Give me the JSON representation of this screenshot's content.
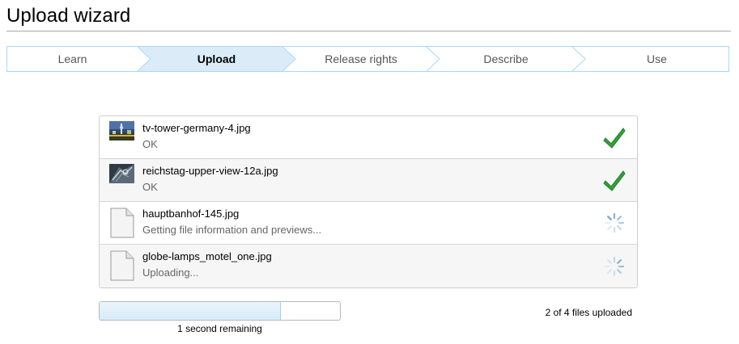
{
  "page": {
    "title": "Upload wizard"
  },
  "steps": [
    {
      "label": "Learn",
      "active": false
    },
    {
      "label": "Upload",
      "active": true
    },
    {
      "label": "Release rights",
      "active": false
    },
    {
      "label": "Describe",
      "active": false
    },
    {
      "label": "Use",
      "active": false
    }
  ],
  "files": [
    {
      "name": "tv-tower-germany-4.jpg",
      "status": "OK",
      "state": "done",
      "thumbnail": "photo"
    },
    {
      "name": "reichstag-upper-view-12a.jpg",
      "status": "OK",
      "state": "done",
      "thumbnail": "photo"
    },
    {
      "name": "hauptbanhof-145.jpg",
      "status": "Getting file information and previews...",
      "state": "loading",
      "thumbnail": "generic-file"
    },
    {
      "name": "globe-lamps_motel_one.jpg",
      "status": "Uploading...",
      "state": "loading",
      "thumbnail": "generic-file"
    }
  ],
  "progress": {
    "fraction": 0.75,
    "remaining_label": "1 second remaining",
    "count_label": "2 of 4 files uploaded"
  },
  "colors": {
    "step_border": "#a7d7f9",
    "step_active_bg": "#dbecf8",
    "check_green": "#2fa43a"
  }
}
